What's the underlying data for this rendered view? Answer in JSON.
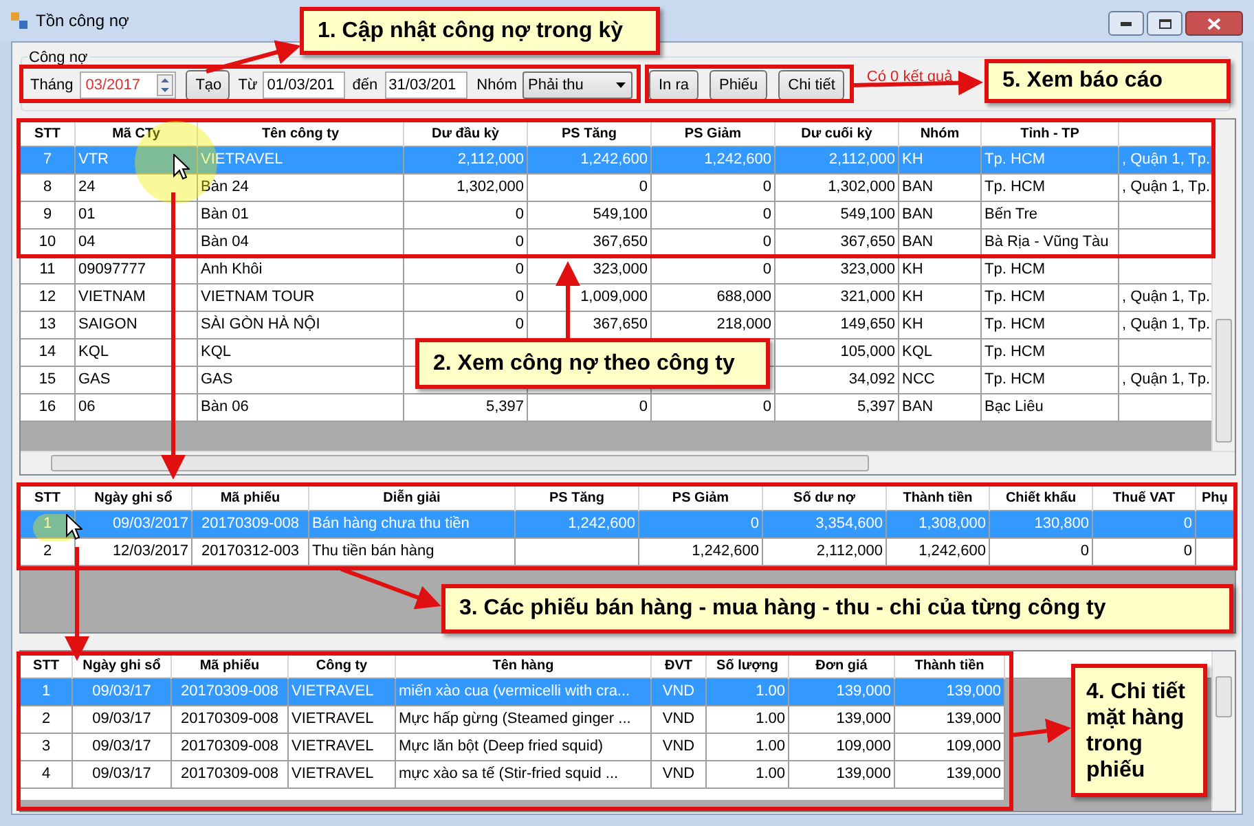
{
  "window": {
    "title": "Tồn công nợ"
  },
  "filter": {
    "group_label": "Công nợ",
    "month_label": "Tháng",
    "month": "03/2017",
    "create_button": "Tạo",
    "from_label": "Từ",
    "from": "01/03/201",
    "to_label": "đến",
    "to": "31/03/201",
    "group_field_label": "Nhóm",
    "group_value": "Phải thu",
    "buttons": [
      "In ra",
      "Phiếu",
      "Chi tiết"
    ],
    "result": "Có 0 kết quả"
  },
  "grids": [
    {
      "columns": [
        "STT",
        "Mã CTy",
        "Tên công ty",
        "Dư đầu kỳ",
        "PS Tăng",
        "PS Giảm",
        "Dư cuối kỳ",
        "Nhóm",
        "Tỉnh - TP"
      ],
      "rows": [
        {
          "selected": true,
          "cells": [
            "7",
            "VTR",
            "VIETRAVEL",
            "2,112,000",
            "1,242,600",
            "1,242,600",
            "2,112,000",
            "KH",
            "Tp. HCM",
            ", Quận 1, Tp."
          ]
        },
        {
          "selected": false,
          "cells": [
            "8",
            "24",
            "Bàn 24",
            "1,302,000",
            "0",
            "0",
            "1,302,000",
            "BAN",
            "Tp. HCM",
            ", Quận 1, Tp."
          ]
        },
        {
          "selected": false,
          "cells": [
            "9",
            "01",
            "Bàn 01",
            "0",
            "549,100",
            "0",
            "549,100",
            "BAN",
            "Bến Tre",
            ""
          ]
        },
        {
          "selected": false,
          "cells": [
            "10",
            "04",
            "Bàn 04",
            "0",
            "367,650",
            "0",
            "367,650",
            "BAN",
            "Bà Rịa - Vũng Tàu",
            ""
          ]
        },
        {
          "selected": false,
          "cells": [
            "11",
            "09097777",
            "Anh Khôi",
            "0",
            "323,000",
            "0",
            "323,000",
            "KH",
            "Tp. HCM",
            ""
          ]
        },
        {
          "selected": false,
          "cells": [
            "12",
            "VIETNAM",
            "VIETNAM TOUR",
            "0",
            "1,009,000",
            "688,000",
            "321,000",
            "KH",
            "Tp. HCM",
            ", Quận 1, Tp."
          ]
        },
        {
          "selected": false,
          "cells": [
            "13",
            "SAIGON",
            "SÀI GÒN HÀ NỘI",
            "0",
            "367,650",
            "218,000",
            "149,650",
            "KH",
            "Tp. HCM",
            ", Quận 1, Tp."
          ]
        },
        {
          "selected": false,
          "cells": [
            "14",
            "KQL",
            "KQL",
            "",
            "",
            "",
            "105,000",
            "KQL",
            "Tp. HCM",
            ""
          ]
        },
        {
          "selected": false,
          "cells": [
            "15",
            "GAS",
            "GAS",
            "",
            "",
            "",
            "34,092",
            "NCC",
            "Tp. HCM",
            ", Quận 1, Tp."
          ]
        },
        {
          "selected": false,
          "cells": [
            "16",
            "06",
            "Bàn 06",
            "5,397",
            "0",
            "0",
            "5,397",
            "BAN",
            "Bạc Liêu",
            ""
          ]
        }
      ]
    },
    {
      "columns": [
        "STT",
        "Ngày ghi sổ",
        "Mã phiếu",
        "Diễn giải",
        "PS Tăng",
        "PS Giảm",
        "Số dư nợ",
        "Thành tiền",
        "Chiết khấu",
        "Thuế VAT",
        "Phụ"
      ],
      "rows": [
        {
          "selected": true,
          "cells": [
            "1",
            "09/03/2017",
            "20170309-008",
            "Bán hàng chưa thu tiền",
            "1,242,600",
            "0",
            "3,354,600",
            "1,308,000",
            "130,800",
            "0",
            ""
          ]
        },
        {
          "selected": false,
          "cells": [
            "2",
            "12/03/2017",
            "20170312-003",
            "Thu tiền bán hàng",
            "",
            "1,242,600",
            "2,112,000",
            "1,242,600",
            "0",
            "0",
            ""
          ]
        }
      ]
    },
    {
      "columns": [
        "STT",
        "Ngày ghi sổ",
        "Mã phiếu",
        "Công ty",
        "Tên hàng",
        "ĐVT",
        "Số lượng",
        "Đơn giá",
        "Thành tiền"
      ],
      "rows": [
        {
          "selected": true,
          "cells": [
            "1",
            "09/03/17",
            "20170309-008",
            "VIETRAVEL",
            "miến xào cua (vermicelli with cra...",
            "VND",
            "1.00",
            "139,000",
            "139,000"
          ]
        },
        {
          "selected": false,
          "cells": [
            "2",
            "09/03/17",
            "20170309-008",
            "VIETRAVEL",
            "Mực hấp gừng (Steamed ginger ...",
            "VND",
            "1.00",
            "139,000",
            "139,000"
          ]
        },
        {
          "selected": false,
          "cells": [
            "3",
            "09/03/17",
            "20170309-008",
            "VIETRAVEL",
            "Mực lăn bột (Deep fried squid)",
            "VND",
            "1.00",
            "109,000",
            "109,000"
          ]
        },
        {
          "selected": false,
          "cells": [
            "4",
            "09/03/17",
            "20170309-008",
            "VIETRAVEL",
            "mực xào sa tế (Stir-fried squid ...",
            "VND",
            "1.00",
            "139,000",
            "139,000"
          ]
        }
      ]
    }
  ],
  "callouts": [
    "1. Cập nhật công nợ trong kỳ",
    "5. Xem báo cáo",
    "2. Xem công nợ theo công ty",
    "3. Các phiếu bán hàng - mua hàng - thu - chi của từng công ty",
    "4. Chi tiết mặt hàng trong phiếu"
  ]
}
